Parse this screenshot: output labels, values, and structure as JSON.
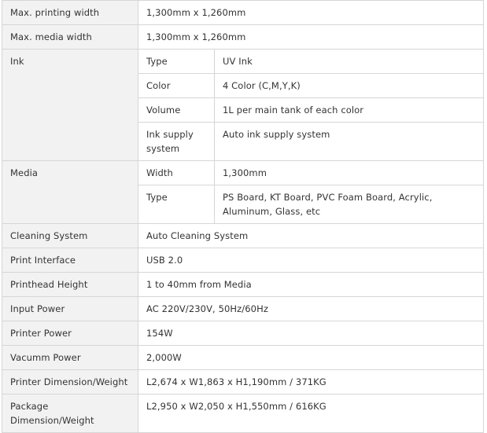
{
  "rows": {
    "max_printing_width": {
      "label": "Max. printing width",
      "value": "1,300mm x 1,260mm"
    },
    "max_media_width": {
      "label": "Max. media width",
      "value": "1,300mm x 1,260mm"
    },
    "ink": {
      "label": "Ink",
      "type": {
        "label": "Type",
        "value": "UV Ink"
      },
      "color": {
        "label": "Color",
        "value": "4 Color (C,M,Y,K)"
      },
      "volume": {
        "label": "Volume",
        "value": "1L per main tank of each color"
      },
      "supply": {
        "label": "Ink supply system",
        "value": "Auto ink supply system"
      }
    },
    "media": {
      "label": "Media",
      "width": {
        "label": "Width",
        "value": "1,300mm"
      },
      "type": {
        "label": "Type",
        "value": "PS Board, KT Board, PVC Foam Board, Acrylic, Aluminum, Glass, etc"
      }
    },
    "cleaning_system": {
      "label": "Cleaning System",
      "value": "Auto Cleaning System"
    },
    "print_interface": {
      "label": "Print Interface",
      "value": "USB 2.0"
    },
    "printhead_height": {
      "label": "Printhead Height",
      "value": "1 to 40mm from Media"
    },
    "input_power": {
      "label": "Input Power",
      "value": "AC 220V/230V, 50Hz/60Hz"
    },
    "printer_power": {
      "label": "Printer Power",
      "value": "154W"
    },
    "vacuum_power": {
      "label": "Vacumm Power",
      "value": "2,000W"
    },
    "printer_dimension": {
      "label": "Printer Dimension/Weight",
      "value": "L2,674 x W1,863 x H1,190mm / 371KG"
    },
    "package_dimension": {
      "label": "Package Dimension/Weight",
      "value": "L2,950 x W2,050 x H1,550mm / 616KG"
    }
  }
}
